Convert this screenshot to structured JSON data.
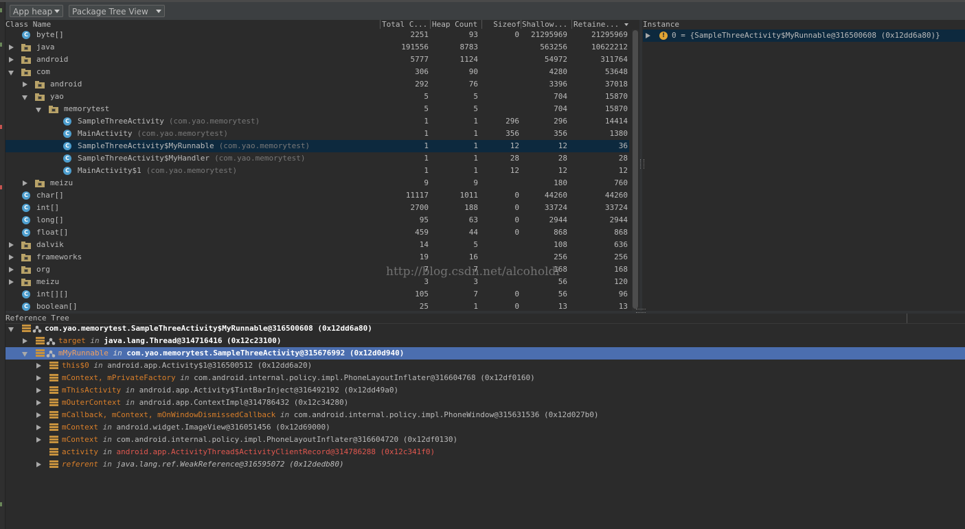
{
  "toolbar": {
    "heap_select": "App heap",
    "view_select": "Package Tree View"
  },
  "class_table": {
    "headers": [
      "Class Name",
      "Total C...",
      "Heap Count",
      "Sizeof",
      "Shallow...",
      "Retaine..."
    ],
    "rows": [
      {
        "depth": 0,
        "expander": "none",
        "icon": "class",
        "name": "byte[]",
        "pkg": "",
        "total": "2251",
        "heap": "93",
        "sizeof": "0",
        "shallow": "21295969",
        "retained": "21295969"
      },
      {
        "depth": 0,
        "expander": "collapsed",
        "icon": "package",
        "name": "java",
        "pkg": "",
        "total": "191556",
        "heap": "8783",
        "sizeof": "",
        "shallow": "563256",
        "retained": "10622212"
      },
      {
        "depth": 0,
        "expander": "collapsed",
        "icon": "package",
        "name": "android",
        "pkg": "",
        "total": "5777",
        "heap": "1124",
        "sizeof": "",
        "shallow": "54972",
        "retained": "311764"
      },
      {
        "depth": 0,
        "expander": "expanded",
        "icon": "package",
        "name": "com",
        "pkg": "",
        "total": "306",
        "heap": "90",
        "sizeof": "",
        "shallow": "4280",
        "retained": "53648"
      },
      {
        "depth": 1,
        "expander": "collapsed",
        "icon": "package",
        "name": "android",
        "pkg": "",
        "total": "292",
        "heap": "76",
        "sizeof": "",
        "shallow": "3396",
        "retained": "37018"
      },
      {
        "depth": 1,
        "expander": "expanded",
        "icon": "package",
        "name": "yao",
        "pkg": "",
        "total": "5",
        "heap": "5",
        "sizeof": "",
        "shallow": "704",
        "retained": "15870"
      },
      {
        "depth": 2,
        "expander": "expanded",
        "icon": "package",
        "name": "memorytest",
        "pkg": "",
        "total": "5",
        "heap": "5",
        "sizeof": "",
        "shallow": "704",
        "retained": "15870"
      },
      {
        "depth": 3,
        "expander": "none",
        "icon": "class",
        "name": "SampleThreeActivity",
        "pkg": "(com.yao.memorytest)",
        "total": "1",
        "heap": "1",
        "sizeof": "296",
        "shallow": "296",
        "retained": "14414"
      },
      {
        "depth": 3,
        "expander": "none",
        "icon": "class",
        "name": "MainActivity",
        "pkg": "(com.yao.memorytest)",
        "total": "1",
        "heap": "1",
        "sizeof": "356",
        "shallow": "356",
        "retained": "1380"
      },
      {
        "depth": 3,
        "expander": "none",
        "icon": "class",
        "name": "SampleThreeActivity$MyRunnable",
        "pkg": "(com.yao.memorytest)",
        "total": "1",
        "heap": "1",
        "sizeof": "12",
        "shallow": "12",
        "retained": "36",
        "selected": true
      },
      {
        "depth": 3,
        "expander": "none",
        "icon": "class",
        "name": "SampleThreeActivity$MyHandler",
        "pkg": "(com.yao.memorytest)",
        "total": "1",
        "heap": "1",
        "sizeof": "28",
        "shallow": "28",
        "retained": "28"
      },
      {
        "depth": 3,
        "expander": "none",
        "icon": "class",
        "name": "MainActivity$1",
        "pkg": "(com.yao.memorytest)",
        "total": "1",
        "heap": "1",
        "sizeof": "12",
        "shallow": "12",
        "retained": "12"
      },
      {
        "depth": 1,
        "expander": "collapsed",
        "icon": "package",
        "name": "meizu",
        "pkg": "",
        "total": "9",
        "heap": "9",
        "sizeof": "",
        "shallow": "180",
        "retained": "760"
      },
      {
        "depth": 0,
        "expander": "none",
        "icon": "class",
        "name": "char[]",
        "pkg": "",
        "total": "11117",
        "heap": "1011",
        "sizeof": "0",
        "shallow": "44260",
        "retained": "44260"
      },
      {
        "depth": 0,
        "expander": "none",
        "icon": "class",
        "name": "int[]",
        "pkg": "",
        "total": "2700",
        "heap": "188",
        "sizeof": "0",
        "shallow": "33724",
        "retained": "33724"
      },
      {
        "depth": 0,
        "expander": "none",
        "icon": "class",
        "name": "long[]",
        "pkg": "",
        "total": "95",
        "heap": "63",
        "sizeof": "0",
        "shallow": "2944",
        "retained": "2944"
      },
      {
        "depth": 0,
        "expander": "none",
        "icon": "class",
        "name": "float[]",
        "pkg": "",
        "total": "459",
        "heap": "44",
        "sizeof": "0",
        "shallow": "868",
        "retained": "868"
      },
      {
        "depth": 0,
        "expander": "collapsed",
        "icon": "package",
        "name": "dalvik",
        "pkg": "",
        "total": "14",
        "heap": "5",
        "sizeof": "",
        "shallow": "108",
        "retained": "636"
      },
      {
        "depth": 0,
        "expander": "collapsed",
        "icon": "package",
        "name": "frameworks",
        "pkg": "",
        "total": "19",
        "heap": "16",
        "sizeof": "",
        "shallow": "256",
        "retained": "256"
      },
      {
        "depth": 0,
        "expander": "collapsed",
        "icon": "package",
        "name": "org",
        "pkg": "",
        "total": "7",
        "heap": "7",
        "sizeof": "",
        "shallow": "168",
        "retained": "168"
      },
      {
        "depth": 0,
        "expander": "collapsed",
        "icon": "package",
        "name": "meizu",
        "pkg": "",
        "total": "3",
        "heap": "3",
        "sizeof": "",
        "shallow": "56",
        "retained": "120"
      },
      {
        "depth": 0,
        "expander": "none",
        "icon": "class",
        "name": "int[][]",
        "pkg": "",
        "total": "105",
        "heap": "7",
        "sizeof": "0",
        "shallow": "56",
        "retained": "96"
      },
      {
        "depth": 0,
        "expander": "none",
        "icon": "class",
        "name": "boolean[]",
        "pkg": "",
        "total": "25",
        "heap": "1",
        "sizeof": "0",
        "shallow": "13",
        "retained": "13"
      }
    ]
  },
  "instance_panel": {
    "title": "Instance",
    "row": "0 = {SampleThreeActivity$MyRunnable@316500608 (0x12dd6a80)}"
  },
  "reference_tree": {
    "title": "Reference Tree",
    "rows": [
      {
        "depth": 0,
        "expander": "expanded",
        "field": "",
        "in": "",
        "object": "com.yao.memorytest.SampleThreeActivity$MyRunnable@316500608 (0x12dd6a80)",
        "style": "root"
      },
      {
        "depth": 1,
        "expander": "collapsed",
        "field": "target",
        "in": "in",
        "object": "java.lang.Thread@314716416 (0x12c23100)",
        "style": "bold"
      },
      {
        "depth": 1,
        "expander": "expanded",
        "field": "mMyRunnable",
        "in": "in",
        "object": "com.yao.memorytest.SampleThreeActivity@315676992 (0x12d0d940)",
        "style": "selected"
      },
      {
        "depth": 2,
        "expander": "collapsed",
        "field": "this$0",
        "in": "in",
        "object": "android.app.Activity$1@316500512 (0x12dd6a20)",
        "style": "normal"
      },
      {
        "depth": 2,
        "expander": "collapsed",
        "field": "mContext, mPrivateFactory",
        "in": "in",
        "object": "com.android.internal.policy.impl.PhoneLayoutInflater@316604768 (0x12df0160)",
        "style": "normal"
      },
      {
        "depth": 2,
        "expander": "collapsed",
        "field": "mThisActivity",
        "in": "in",
        "object": "android.app.Activity$TintBarInject@316492192 (0x12dd49a0)",
        "style": "normal"
      },
      {
        "depth": 2,
        "expander": "collapsed",
        "field": "mOuterContext",
        "in": "in",
        "object": "android.app.ContextImpl@314786432 (0x12c34280)",
        "style": "normal"
      },
      {
        "depth": 2,
        "expander": "collapsed",
        "field": "mCallback, mContext, mOnWindowDismissedCallback",
        "in": "in",
        "object": "com.android.internal.policy.impl.PhoneWindow@315631536 (0x12d027b0)",
        "style": "normal"
      },
      {
        "depth": 2,
        "expander": "collapsed",
        "field": "mContext",
        "in": "in",
        "object": "android.widget.ImageView@316051456 (0x12d69000)",
        "style": "normal"
      },
      {
        "depth": 2,
        "expander": "collapsed",
        "field": "mContext",
        "in": "in",
        "object": "com.android.internal.policy.impl.PhoneLayoutInflater@316604720 (0x12df0130)",
        "style": "normal"
      },
      {
        "depth": 2,
        "expander": "none",
        "field": "activity",
        "in": "in",
        "object": "android.app.ActivityThread$ActivityClientRecord@314786288 (0x12c341f0)",
        "style": "red"
      },
      {
        "depth": 2,
        "expander": "collapsed",
        "field": "referent",
        "in": "in",
        "object": "java.lang.ref.WeakReference@316595072 (0x12dedb80)",
        "style": "weak"
      }
    ]
  },
  "watermark": "http://blog.csdn.net/alcoholdi",
  "colors": {
    "background": "#2b2b2b",
    "selection_focused": "#4b6eaf",
    "selection_unfocused": "#0d293e",
    "field": "#d97f2a",
    "gc_root_red": "#e0574f",
    "class_icon": "#4e9fcf"
  }
}
